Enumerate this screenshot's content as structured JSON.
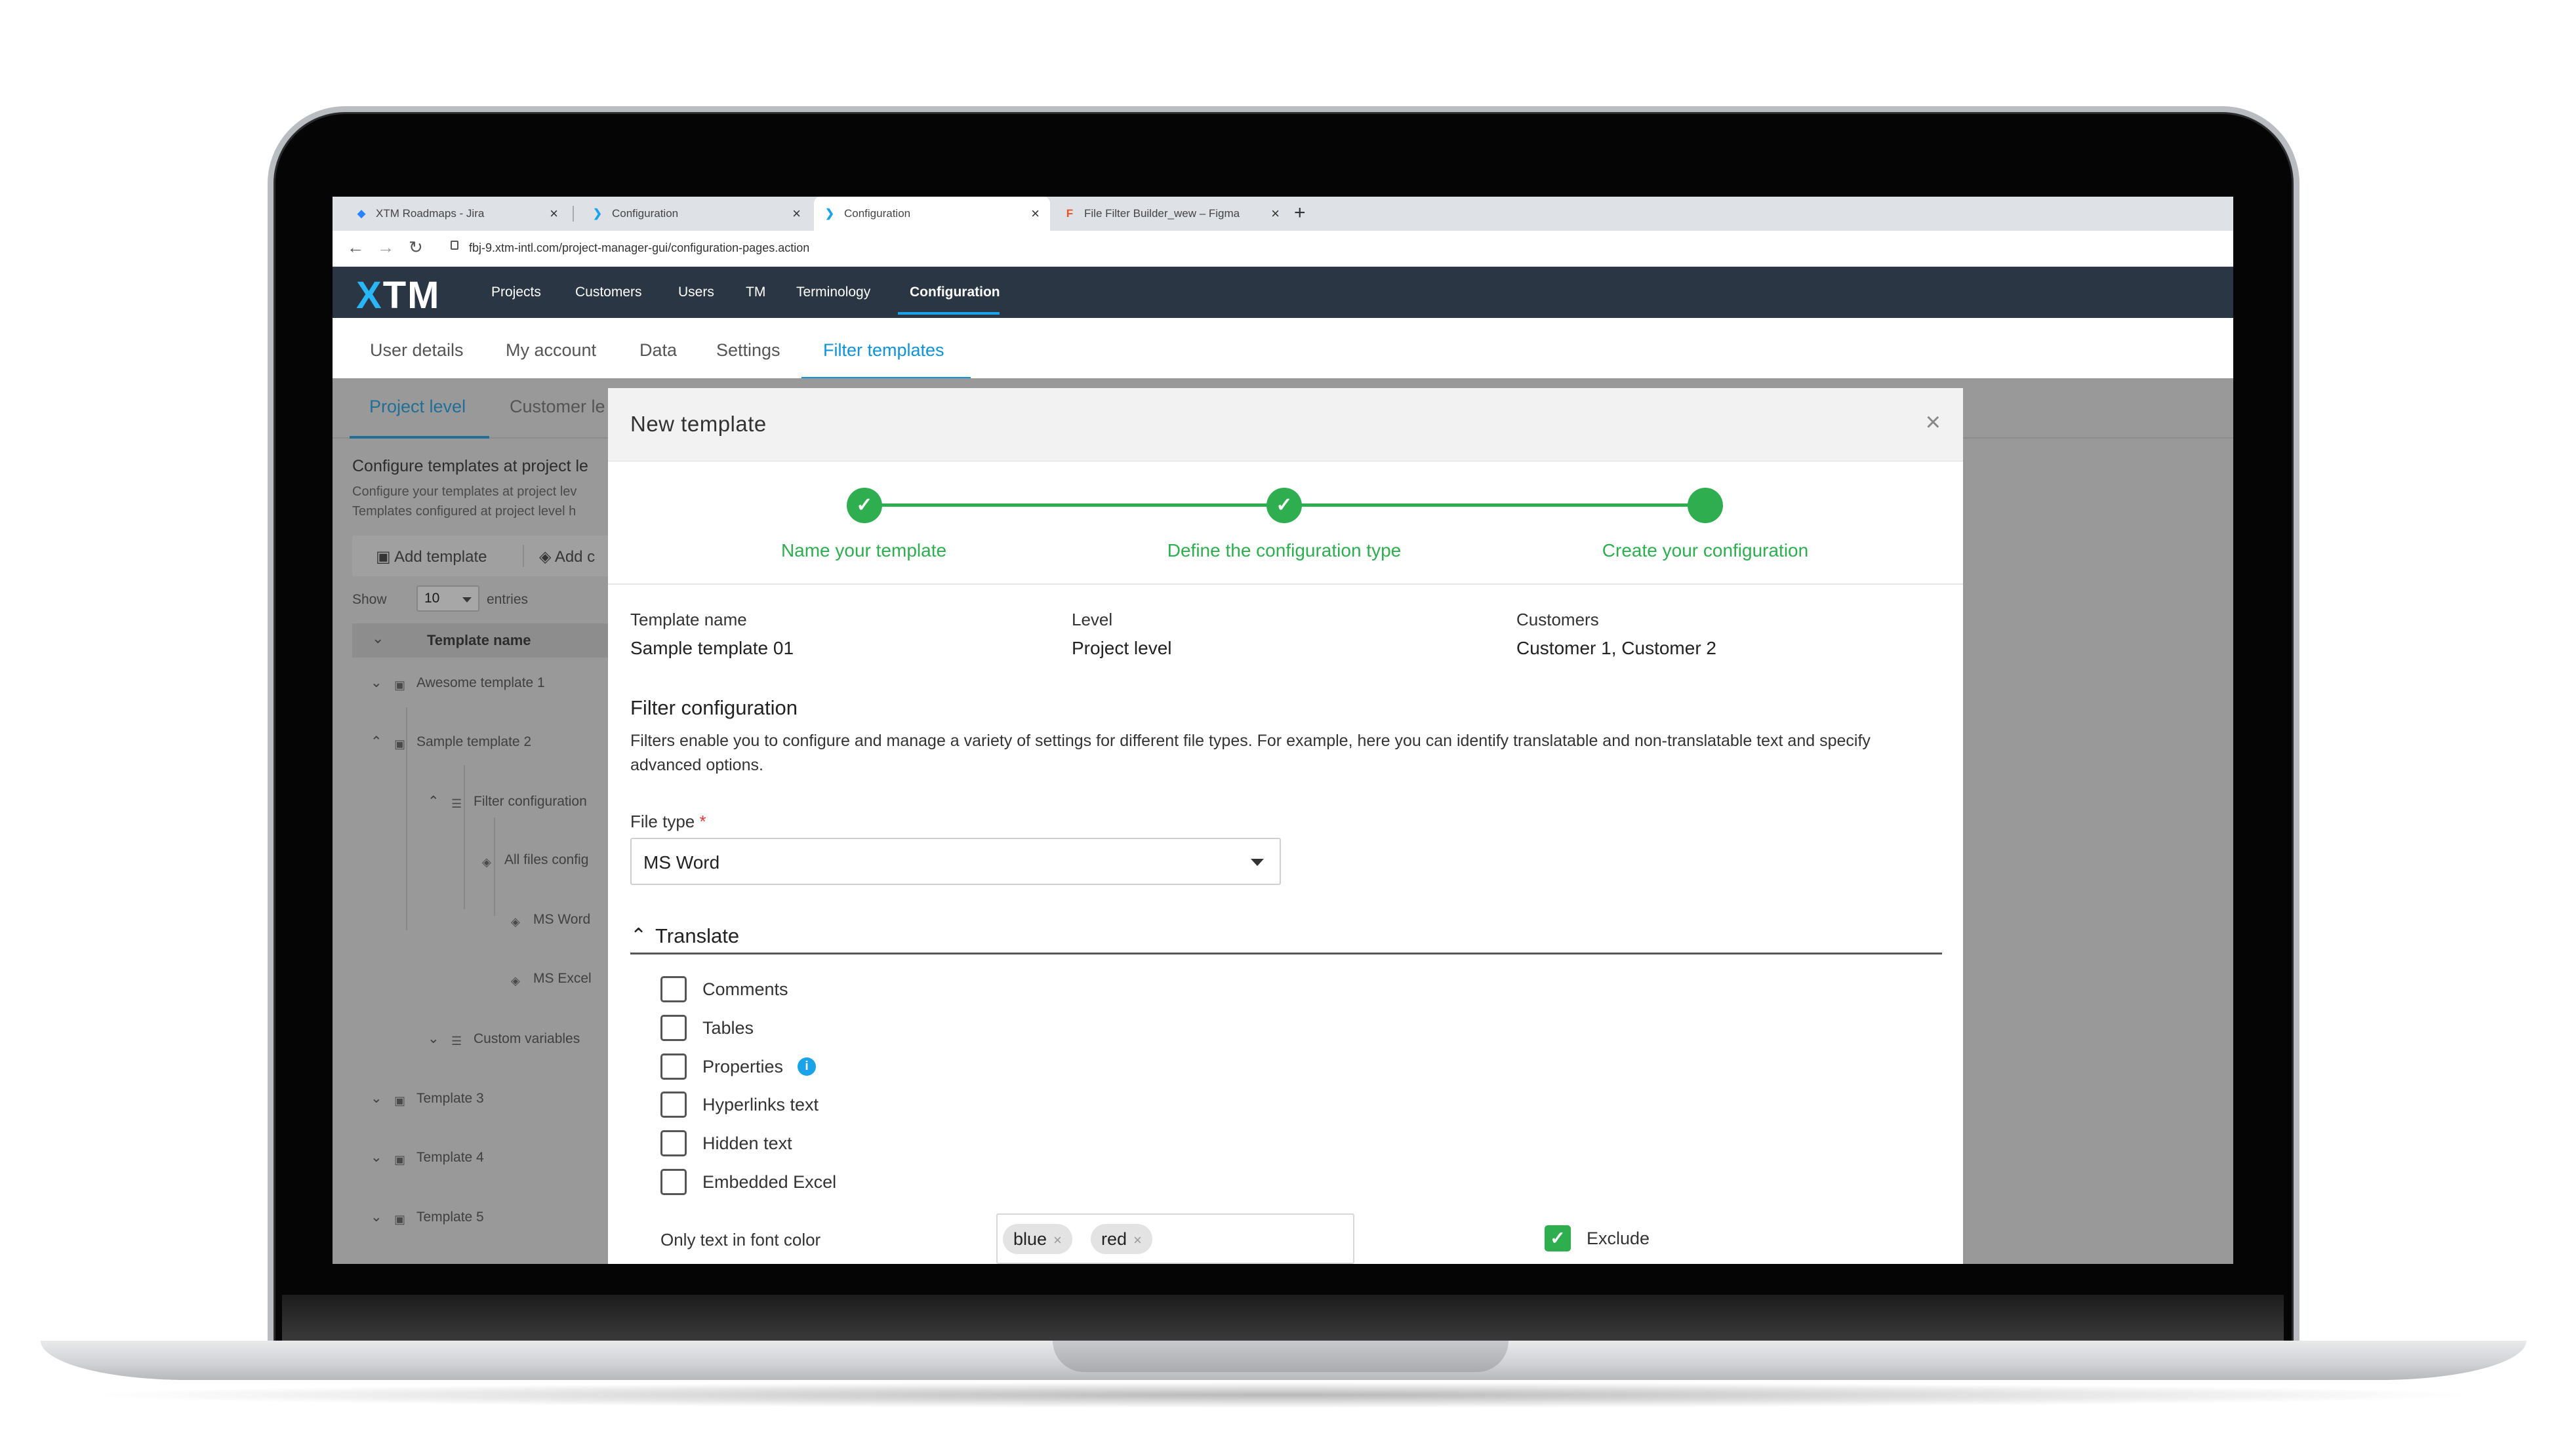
{
  "browser": {
    "tabs": [
      {
        "title": "XTM Roadmaps - Jira",
        "icon": "jira-icon"
      },
      {
        "title": "Configuration",
        "icon": "xtm-icon"
      },
      {
        "title": "Configuration",
        "icon": "xtm-icon"
      },
      {
        "title": "File Filter Builder_wew – Figma",
        "icon": "figma-icon"
      }
    ],
    "url": "fbj-9.xtm-intl.com/project-manager-gui/configuration-pages.action"
  },
  "app": {
    "logo": {
      "x": "X",
      "rest": "TM"
    },
    "top_nav": [
      "Projects",
      "Customers",
      "Users",
      "TM",
      "Terminology",
      "Configuration"
    ],
    "sub_nav": [
      "User details",
      "My account",
      "Data",
      "Settings",
      "Filter templates"
    ]
  },
  "background": {
    "level_tabs": [
      "Project level",
      "Customer le"
    ],
    "title": "Configure templates at project le",
    "lines": [
      "Configure your templates at project lev",
      "Templates configured at project level h"
    ],
    "toolbar": {
      "add_template": "Add template",
      "add_other": "Add c"
    },
    "show_label": "Show",
    "show_value": "10",
    "entries_label": "entries",
    "table_header": "Template name",
    "tree": [
      "Awesome template 1",
      "Sample template 2",
      "Filter configuration",
      "All files config",
      "MS Word",
      "MS Excel",
      "Custom variables",
      "Template 3",
      "Template 4",
      "Template 5"
    ]
  },
  "modal": {
    "title": "New template",
    "close_icon": "close-icon",
    "steps": [
      "Name your template",
      "Define the configuration type",
      "Create your configuration"
    ],
    "summary": {
      "template_name_label": "Template name",
      "template_name_value": "Sample template 01",
      "level_label": "Level",
      "level_value": "Project level",
      "customers_label": "Customers",
      "customers_value": "Customer 1, Customer 2"
    },
    "filter_title": "Filter configuration",
    "filter_description": "Filters enable you to configure and manage a variety of settings for different file types. For example, here you can identify translatable and non-translatable text and specify advanced options.",
    "file_type_label": "File type",
    "file_type_required": "*",
    "file_type_value": "MS Word",
    "translate_title": "Translate",
    "checkboxes": [
      "Comments",
      "Tables",
      "Properties",
      "Hyperlinks text",
      "Hidden text",
      "Embedded Excel"
    ],
    "font_color_label": "Only text in font color",
    "font_color_tags": [
      "blue",
      "red"
    ],
    "exclude_label": "Exclude"
  },
  "colors": {
    "accent": "#0f93d8",
    "success": "#2eae4f",
    "nav_bg": "#2b3644"
  }
}
